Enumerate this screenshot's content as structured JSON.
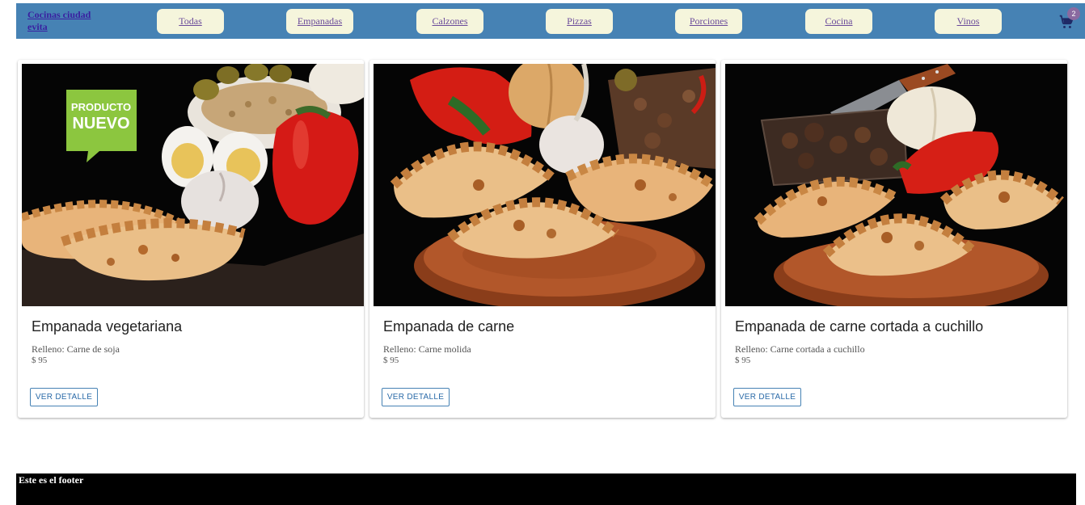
{
  "header": {
    "brand": "Cocinas ciudad evita",
    "nav": [
      {
        "label": "Todas"
      },
      {
        "label": "Empanadas"
      },
      {
        "label": "Calzones"
      },
      {
        "label": "Pizzas"
      },
      {
        "label": "Porciones"
      },
      {
        "label": "Cocina"
      },
      {
        "label": "Vinos"
      }
    ],
    "cart_count": "2",
    "cart_icon": "shopping-cart-icon"
  },
  "products": [
    {
      "badge_line1": "PRODUCTO",
      "badge_line2": "NUEVO",
      "title": "Empanada vegetariana",
      "description": "Relleno: Carne de soja",
      "price": "$ 95",
      "button": "VER DETALLE"
    },
    {
      "title": "Empanada de carne",
      "description": "Relleno: Carne molida",
      "price": "$ 95",
      "button": "VER DETALLE"
    },
    {
      "title": "Empanada de carne cortada a cuchillo",
      "description": "Relleno: Carne cortada a cuchillo",
      "price": "$ 95",
      "button": "VER DETALLE"
    }
  ],
  "footer": {
    "text": "Este es el footer"
  },
  "colors": {
    "navbar": "#4682b4",
    "nav_button": "#f5f5dc",
    "footer": "#000000",
    "badge": "#8cc63f"
  }
}
